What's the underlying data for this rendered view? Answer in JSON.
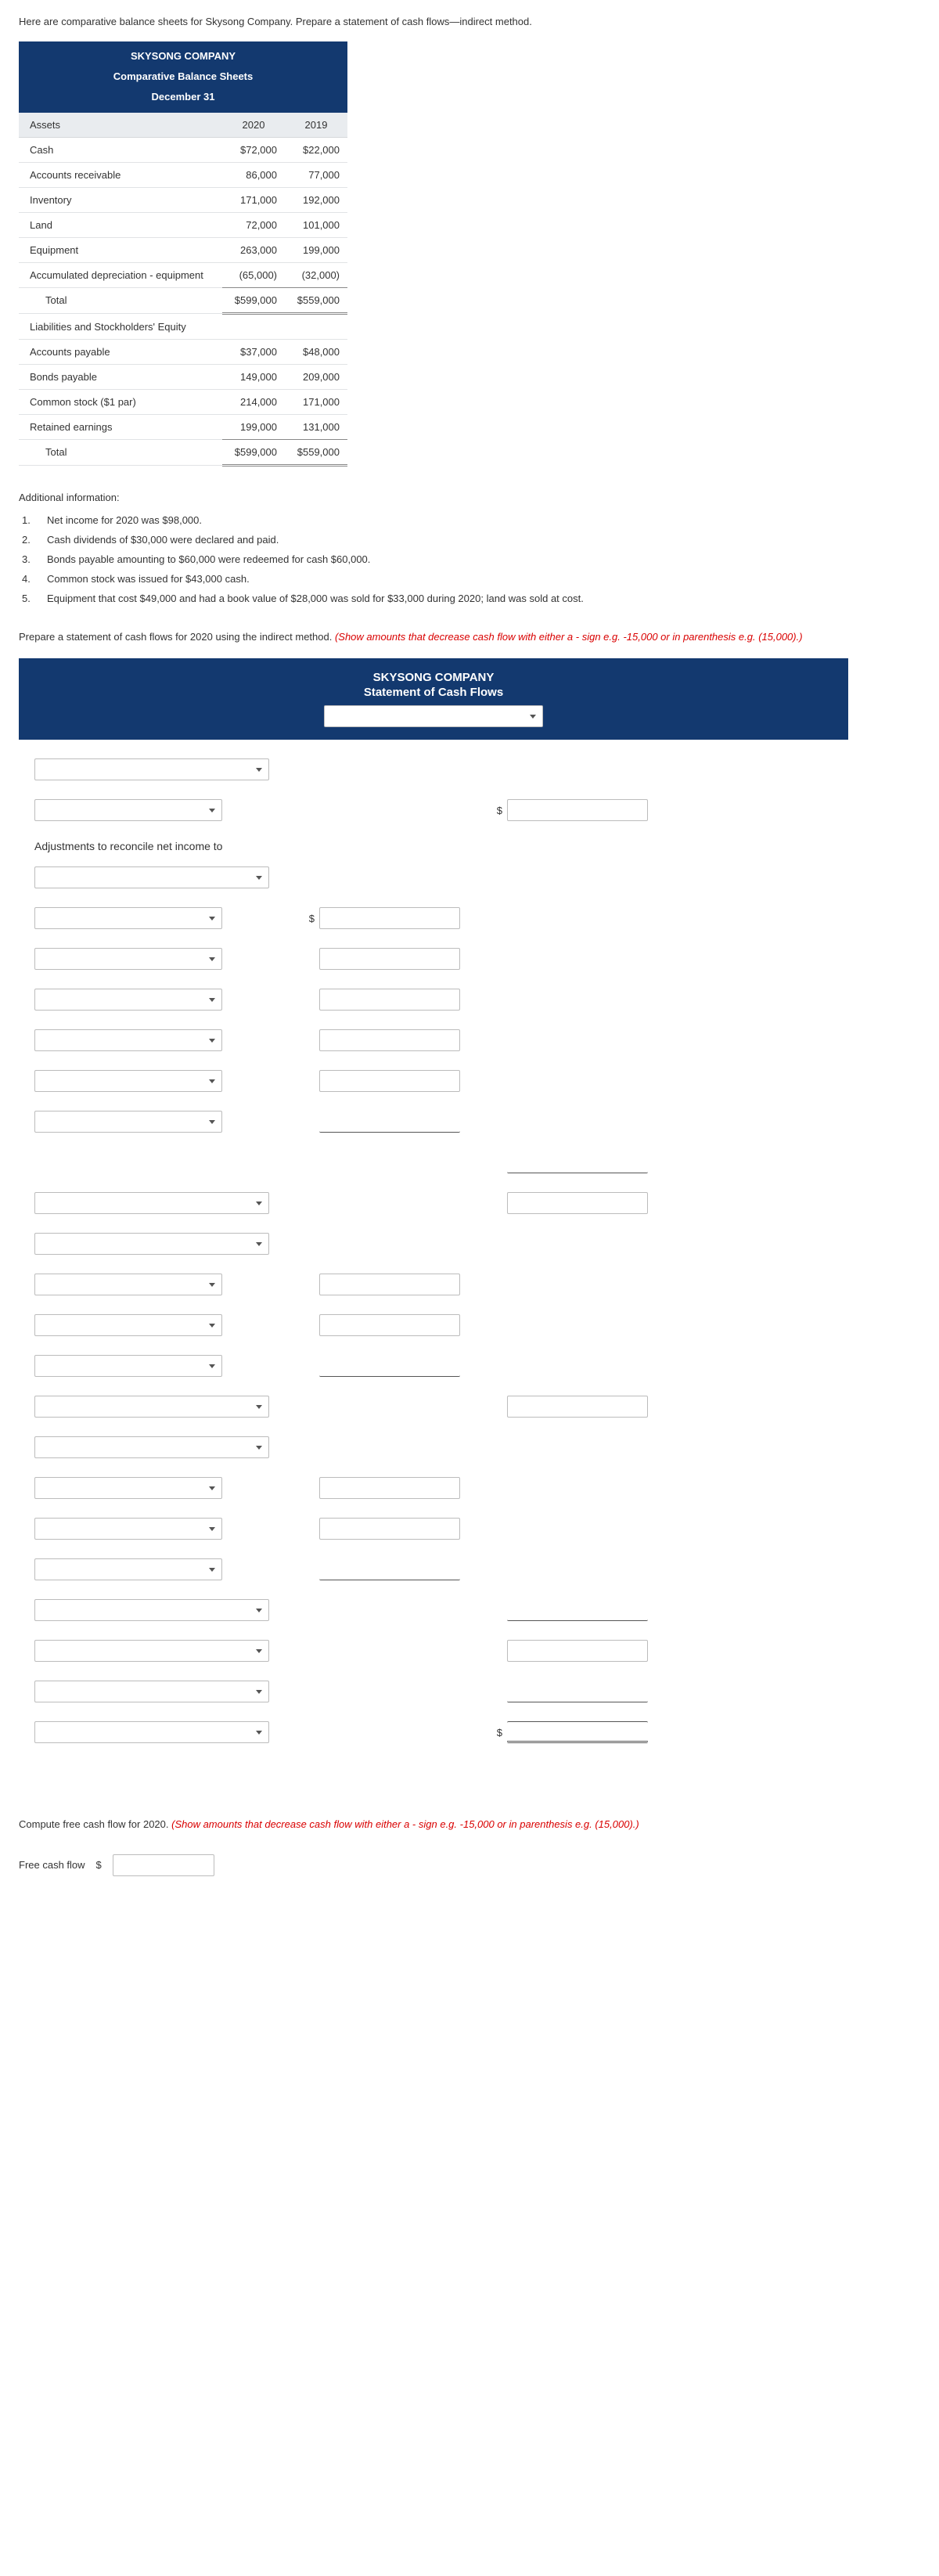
{
  "intro": "Here are comparative balance sheets for Skysong Company. Prepare a statement of cash flows—indirect method.",
  "bs": {
    "company": "SKYSONG COMPANY",
    "title": "Comparative Balance Sheets",
    "date": "December 31",
    "col_assets": "Assets",
    "col_2020": "2020",
    "col_2019": "2019",
    "rows": [
      {
        "label": "Cash",
        "y20": "$72,000",
        "y19": "$22,000"
      },
      {
        "label": "Accounts receivable",
        "y20": "86,000",
        "y19": "77,000"
      },
      {
        "label": "Inventory",
        "y20": "171,000",
        "y19": "192,000"
      },
      {
        "label": "Land",
        "y20": "72,000",
        "y19": "101,000"
      },
      {
        "label": "Equipment",
        "y20": "263,000",
        "y19": "199,000"
      },
      {
        "label": "Accumulated depreciation - equipment",
        "y20": "(65,000)",
        "y19": "(32,000)"
      }
    ],
    "total_label": "Total",
    "total_20": "$599,000",
    "total_19": "$559,000",
    "liab_header": "Liabilities and Stockholders' Equity",
    "liab_rows": [
      {
        "label": "Accounts payable",
        "y20": "$37,000",
        "y19": "$48,000"
      },
      {
        "label": "Bonds payable",
        "y20": "149,000",
        "y19": "209,000"
      },
      {
        "label": "Common stock ($1 par)",
        "y20": "214,000",
        "y19": "171,000"
      },
      {
        "label": "Retained earnings",
        "y20": "199,000",
        "y19": "131,000"
      }
    ],
    "liab_total_20": "$599,000",
    "liab_total_19": "$559,000"
  },
  "addl": {
    "title": "Additional information:",
    "items": [
      "Net income for 2020 was $98,000.",
      "Cash dividends of $30,000 were declared and paid.",
      "Bonds payable amounting to $60,000 were redeemed for cash $60,000.",
      "Common stock was issued for $43,000 cash.",
      "Equipment that cost $49,000 and had a book value of $28,000 was sold for $33,000 during 2020; land was sold at cost."
    ]
  },
  "instr_main": "Prepare a statement of cash flows for 2020 using the indirect method. ",
  "instr_red": "(Show amounts that decrease cash flow with either a - sign e.g. -15,000 or in parenthesis e.g. (15,000).)",
  "scf": {
    "company": "SKYSONG COMPANY",
    "title": "Statement of Cash Flows",
    "adj_title": "Adjustments to reconcile net income to",
    "dollar": "$"
  },
  "freecash": {
    "instr_main": "Compute free cash flow for 2020. ",
    "instr_red": "(Show amounts that decrease cash flow with either a - sign e.g. -15,000 or in parenthesis e.g. (15,000).)",
    "label": "Free cash flow",
    "dollar": "$"
  }
}
